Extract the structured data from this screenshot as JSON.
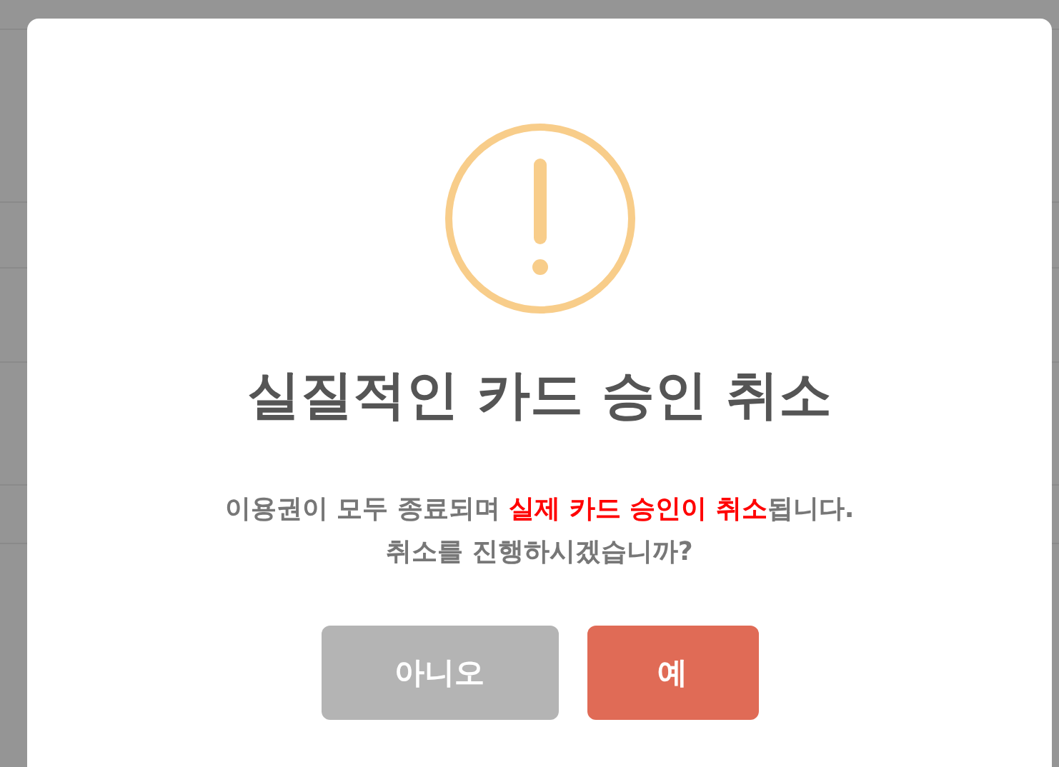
{
  "dialog": {
    "title": "실질적인 카드 승인 취소",
    "message": [
      {
        "text": "이용권이 모두 종료되며 ",
        "highlight": false
      },
      {
        "text": "실제 카드 승인이 취소",
        "highlight": true
      },
      {
        "text": "됩니다.",
        "highlight": false
      }
    ],
    "question": "취소를 진행하시겠습니까?",
    "buttons": [
      {
        "label": "아니오",
        "kind": "cancel"
      },
      {
        "label": "예",
        "kind": "confirm"
      }
    ]
  }
}
